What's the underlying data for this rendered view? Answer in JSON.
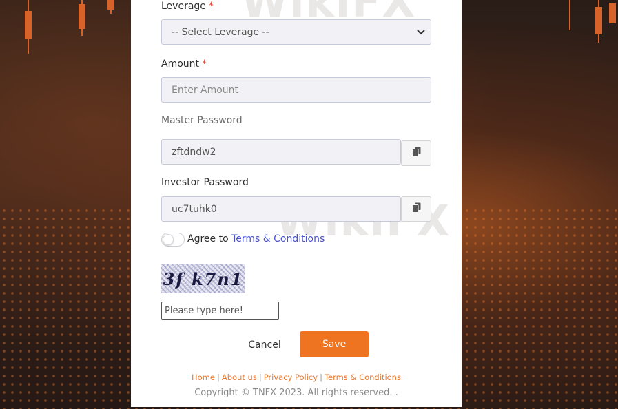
{
  "form": {
    "leverage_label": "Leverage",
    "leverage_required": "*",
    "leverage_selected": "-- Select Leverage --",
    "amount_label": "Amount",
    "amount_required": "*",
    "amount_placeholder": "Enter Amount",
    "master_password_label": "Master Password",
    "master_password_value": "zftdndw2",
    "investor_password_label": "Investor Password",
    "investor_password_value": "uc7tuhk0",
    "agree_prefix": "Agree to",
    "agree_link": "Terms & Conditions",
    "captcha_text": "3f k7n1",
    "captcha_placeholder": "Please type here!",
    "cancel_label": "Cancel",
    "save_label": "Save"
  },
  "footer": {
    "links": [
      "Home",
      "About us",
      "Privacy Policy",
      "Terms & Conditions"
    ],
    "copyright": "Copyright © TNFX 2023. All rights reserved. ."
  },
  "watermark": "WikiFX",
  "colors": {
    "accent": "#ee7421",
    "link": "#4a55c8",
    "required": "#e53935"
  },
  "icons": {
    "copy": "copy-icon",
    "dropdown": "chevron-down-icon",
    "toggle": "toggle-switch"
  }
}
